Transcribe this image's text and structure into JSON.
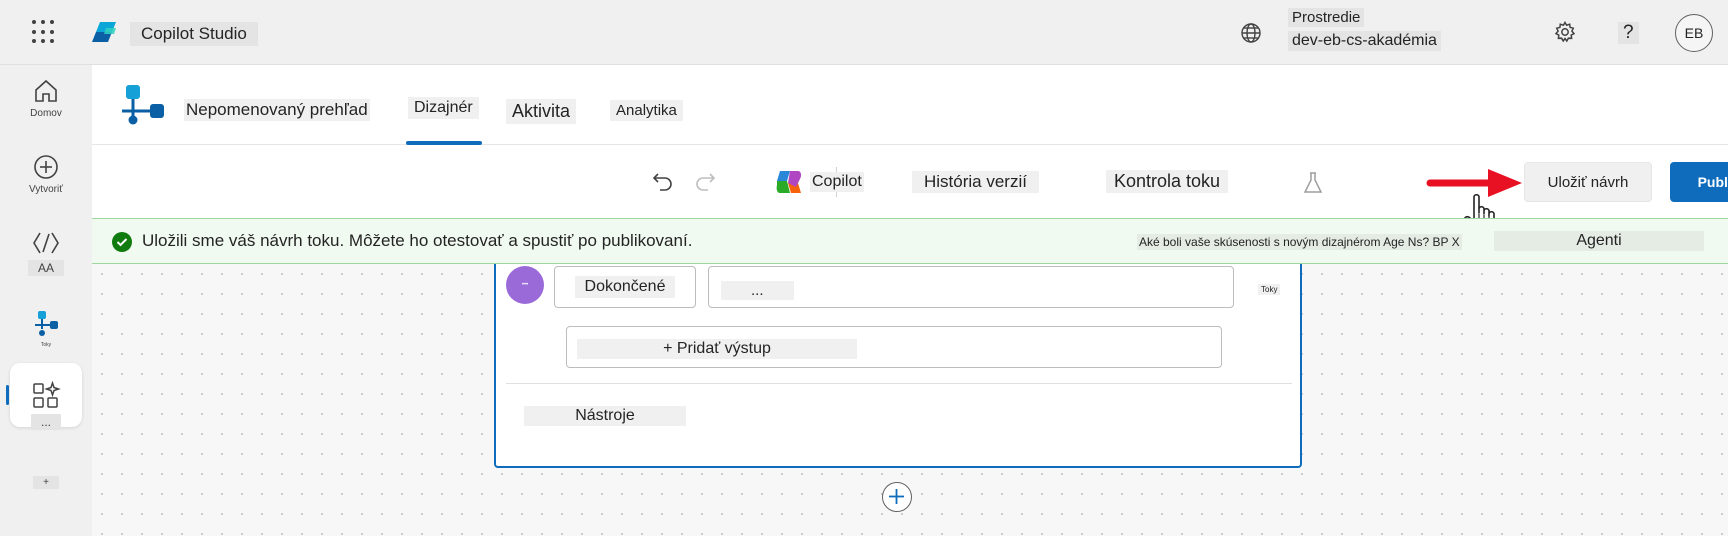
{
  "topbar": {
    "app_title": "Copilot Studio",
    "env_label": "Prostredie",
    "env_name": "dev-eb-cs-akadémia",
    "help": "?",
    "avatar": "EB"
  },
  "rail": {
    "home": "Domov",
    "create": "Vytvoriť",
    "agents": "AA",
    "flows": "Toky",
    "more": "...",
    "plus": "+"
  },
  "header": {
    "flow_name": "Nepomenovaný prehľad",
    "tabs": [
      {
        "label": "Dizajnér"
      },
      {
        "label": "Aktivita"
      },
      {
        "label": "Analytika"
      }
    ]
  },
  "toolbar": {
    "copilot": "Copilot",
    "version_history": "História verzií",
    "flow_checker": "Kontrola toku",
    "save_draft": "Uložiť návrh",
    "publish": "Publikovať"
  },
  "notification": {
    "message": "Uložili sme váš návrh toku. Môžete ho otestovať a spustiť po publikovaní.",
    "feedback": "Aké boli vaše skúsenosti s novým dizajnérom Age Ns? BP X",
    "agents": "Agenti"
  },
  "node": {
    "done_label": "Dokončené",
    "value": "...",
    "side_label": "Toky",
    "add_output": "+ Pridať výstup",
    "tools": "Nástroje"
  },
  "colors": {
    "accent": "#0f6cbd",
    "success": "#107c10",
    "arrow": "#e81123"
  }
}
